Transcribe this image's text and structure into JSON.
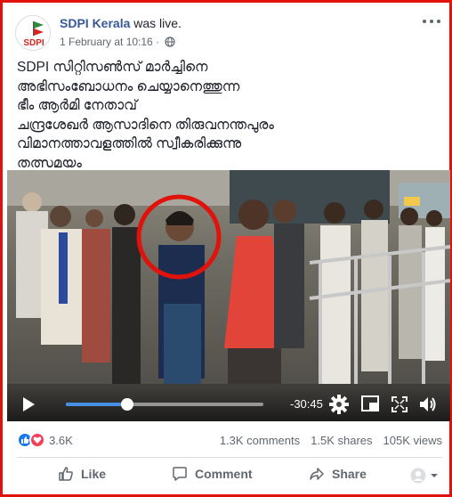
{
  "post": {
    "page_name": "SDPI Kerala",
    "status": "was live.",
    "date": "1 February at 10:16",
    "separator": "·",
    "avatar_text": "SDPI",
    "caption_lines": [
      "SDPI സിറ്റിസൺസ് മാർച്ചിനെ",
      "അഭിസംബോധനം ചെയ്യാനെത്തുന്ന",
      "ഭീം ആർമി നേതാവ്",
      "ചന്ദ്രശേഖർ ആസാദിനെ തിരുവനന്തപുരം",
      "വിമാനത്താവളത്തിൽ സ്വീകരിക്കുന്നു",
      "തത്സമയം"
    ]
  },
  "video": {
    "time_remaining": "-30:45",
    "progress": 0.31,
    "highlight_color": "#e0120b"
  },
  "stats": {
    "reactions_count": "3.6K",
    "comments": "1.3K comments",
    "shares": "1.5K shares",
    "views": "105K views"
  },
  "actions": {
    "like": "Like",
    "comment": "Comment",
    "share": "Share"
  },
  "colors": {
    "frame": "#e0120b",
    "link": "#385898",
    "progress": "#4a90e2"
  }
}
